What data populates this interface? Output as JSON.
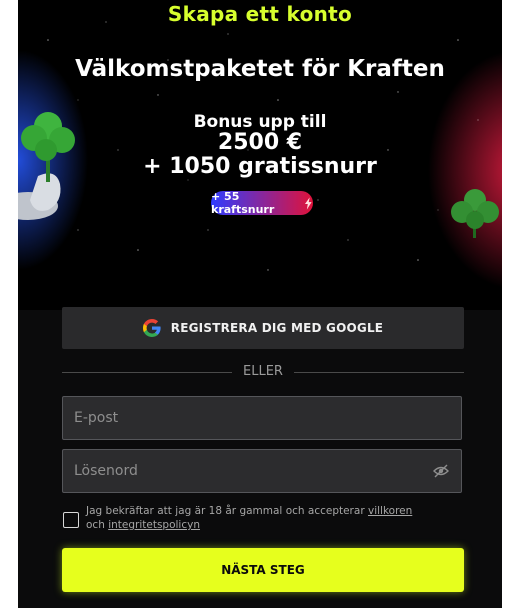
{
  "header": {
    "title": "Skapa ett konto"
  },
  "banner": {
    "headline": "Välkomstpaketet för Kraften",
    "bonus_line1": "Bonus upp till",
    "bonus_line2": "2500 €",
    "bonus_line3": "+ 1050 gratissnurr",
    "pill_text": "+ 55 kraftsnurr",
    "pill_icon": "lightning-icon"
  },
  "google": {
    "label": "REGISTRERA DIG MED GOOGLE",
    "icon": "google-icon"
  },
  "divider": {
    "label": "ELLER"
  },
  "form": {
    "email_placeholder": "E-post",
    "password_placeholder": "Lösenord",
    "password_icon": "eye-off-icon"
  },
  "consent": {
    "text_before": "Jag bekräftar att jag är 18 år gammal och accepterar",
    "terms_link": "villkoren",
    "text_middle": "och",
    "privacy_link": "integritetspolicyn"
  },
  "next_button": {
    "label": "NÄSTA STEG"
  },
  "colors": {
    "accent": "#e6ff1d",
    "background": "#0b0b0c",
    "field": "#2c2c2e"
  }
}
